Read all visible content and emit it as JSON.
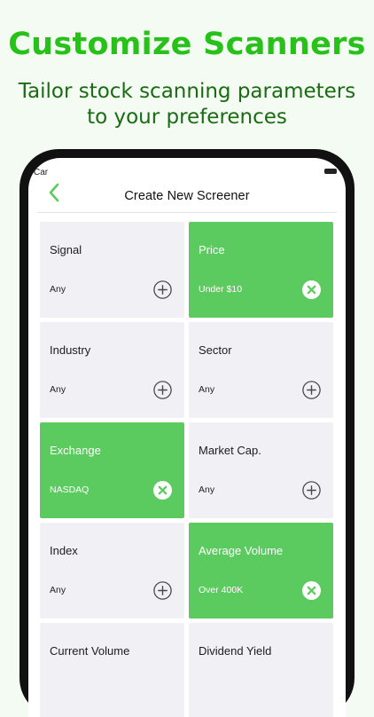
{
  "promo": {
    "title": "Customize Scanners",
    "subtitle_line1": "Tailor stock scanning parameters",
    "subtitle_line2": "to your preferences"
  },
  "status_bar": {
    "carrier": "Car"
  },
  "header": {
    "title": "Create New Screener",
    "back_icon": "chevron-left-icon"
  },
  "colors": {
    "accent": "#5ccb5f",
    "promo_title": "#27c11a",
    "promo_subtitle": "#1a6b14",
    "card": "#f1f1f5"
  },
  "filters": [
    {
      "label": "Signal",
      "value": "Any",
      "selected": false
    },
    {
      "label": "Price",
      "value": "Under $10",
      "selected": true
    },
    {
      "label": "Industry",
      "value": "Any",
      "selected": false
    },
    {
      "label": "Sector",
      "value": "Any",
      "selected": false
    },
    {
      "label": "Exchange",
      "value": "NASDAQ",
      "selected": true
    },
    {
      "label": "Market Cap.",
      "value": "Any",
      "selected": false
    },
    {
      "label": "Index",
      "value": "Any",
      "selected": false
    },
    {
      "label": "Average Volume",
      "value": "Over 400K",
      "selected": true
    },
    {
      "label": "Current Volume",
      "value": "",
      "selected": false
    },
    {
      "label": "Dividend Yield",
      "value": "",
      "selected": false
    }
  ]
}
